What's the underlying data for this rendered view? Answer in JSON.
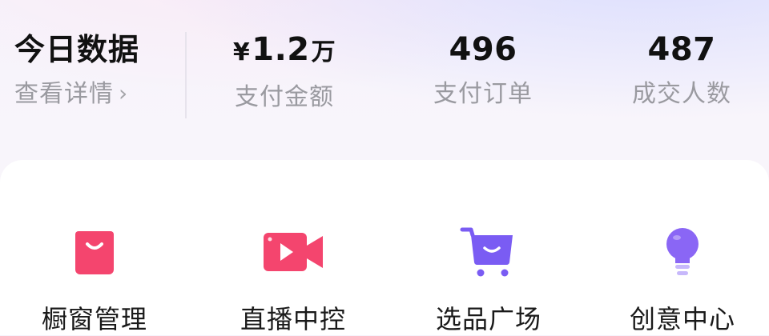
{
  "stats": {
    "title": "今日数据",
    "detail_link": "查看详情",
    "metrics": [
      {
        "currency": "¥",
        "value": "1.2",
        "unit": "万",
        "label": "支付金额"
      },
      {
        "currency": "",
        "value": "496",
        "unit": "",
        "label": "支付订单"
      },
      {
        "currency": "",
        "value": "487",
        "unit": "",
        "label": "成交人数"
      }
    ]
  },
  "tools": {
    "items": [
      {
        "label": "橱窗管理",
        "icon": "shopping-bag-icon",
        "color": "#f4456e"
      },
      {
        "label": "直播中控",
        "icon": "video-camera-icon",
        "color": "#f4456e"
      },
      {
        "label": "选品广场",
        "icon": "shopping-cart-icon",
        "color": "#7a5cf3"
      },
      {
        "label": "创意中心",
        "icon": "lightbulb-icon",
        "color": "#8a66f5"
      }
    ]
  }
}
